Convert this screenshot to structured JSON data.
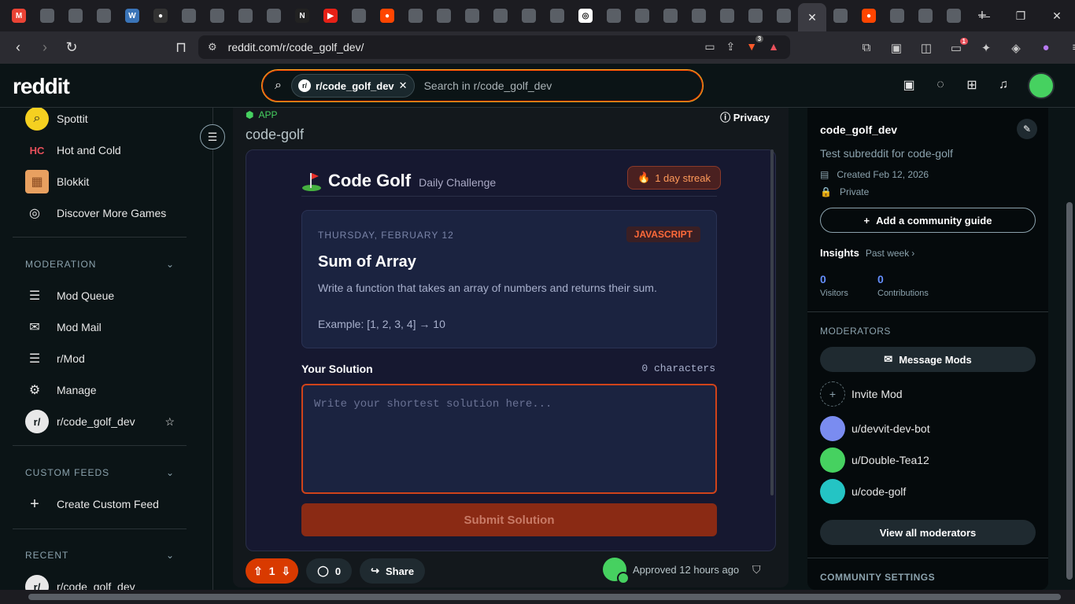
{
  "browser": {
    "url": "reddit.com/r/code_golf_dev/",
    "tab_icons": [
      "gmail-icon",
      "tab-icon",
      "tab-icon",
      "tab-icon",
      "wordpress-icon",
      "github-icon",
      "tab-icon",
      "tab-icon",
      "tab-icon",
      "tab-icon",
      "notion-icon",
      "youtube-icon",
      "tab-icon",
      "reddit-icon",
      "tab-icon",
      "tab-icon",
      "tab-icon",
      "tab-icon",
      "tab-icon",
      "tab-icon",
      "openai-icon",
      "tab-icon",
      "tab-icon",
      "tab-icon",
      "tab-icon",
      "tab-icon",
      "tab-icon",
      "tab-icon",
      "tab-icon",
      "reddit-icon",
      "tab-icon",
      "tab-icon",
      "tab-icon"
    ],
    "shield_badge": "3",
    "wallet_badge": "1",
    "new_tab": "+",
    "close_tab": "✕"
  },
  "header": {
    "logo": "reddit",
    "search_chip": "r/code_golf_dev",
    "search_placeholder": "Search in r/code_golf_dev"
  },
  "sidebar": {
    "games": [
      {
        "label": "Spottit"
      },
      {
        "label": "Hot and Cold"
      },
      {
        "label": "Blokkit"
      },
      {
        "label": "Discover More Games"
      }
    ],
    "moderation_title": "MODERATION",
    "moderation": [
      {
        "label": "Mod Queue"
      },
      {
        "label": "Mod Mail"
      },
      {
        "label": "r/Mod"
      },
      {
        "label": "Manage"
      },
      {
        "label": "r/code_golf_dev"
      }
    ],
    "custom_feeds_title": "CUSTOM FEEDS",
    "create_feed": "Create Custom Feed",
    "recent_title": "RECENT",
    "recent_item": "r/code_golf_dev"
  },
  "post": {
    "app_tag": "APP",
    "privacy": "Privacy",
    "title": "code-golf",
    "app": {
      "name": "Code Golf",
      "subtitle": "Daily Challenge",
      "streak": "1 day streak",
      "date": "THURSDAY, FEBRUARY 12",
      "language": "JAVASCRIPT",
      "challenge_title": "Sum of Array",
      "description": "Write a function that takes an array of numbers and returns their sum.",
      "example": "Example: [1, 2, 3, 4] → 10",
      "solution_label": "Your Solution",
      "char_count": "0 characters",
      "editor_placeholder": "Write your shortest solution here...",
      "submit_label": "Submit Solution"
    },
    "votes": "1",
    "comments": "0",
    "share": "Share",
    "approved": "Approved 12 hours ago"
  },
  "community": {
    "name": "code_golf_dev",
    "description": "Test subreddit for code-golf",
    "created": "Created Feb 12, 2026",
    "visibility": "Private",
    "guide_button": "Add a community guide",
    "insights": "Insights",
    "insights_period": "Past week",
    "visitors": "0",
    "visitors_label": "Visitors",
    "contributions": "0",
    "contributions_label": "Contributions",
    "moderators_title": "MODERATORS",
    "message_mods": "Message Mods",
    "invite_mod": "Invite Mod",
    "mods": [
      {
        "name": "u/devvit-dev-bot",
        "color": "#7a8cf0"
      },
      {
        "name": "u/Double-Tea12",
        "color": "#46d160"
      },
      {
        "name": "u/code-golf",
        "color": "#24c4c4"
      }
    ],
    "view_all": "View all moderators",
    "settings_title": "COMMUNITY SETTINGS"
  }
}
